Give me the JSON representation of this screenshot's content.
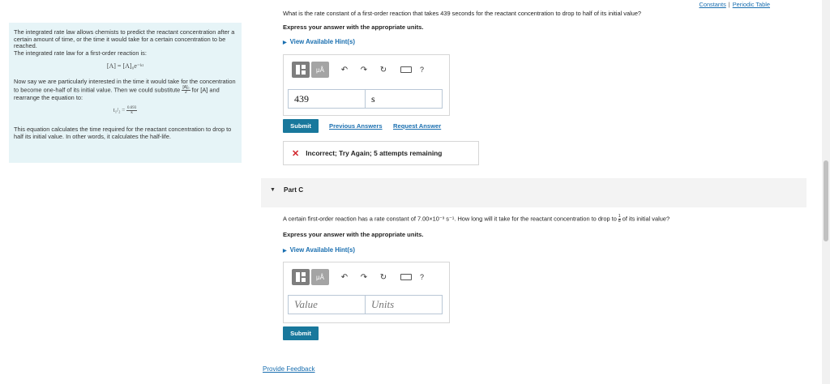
{
  "links": {
    "constants": "Constants",
    "separator": "|",
    "periodic_table": "Periodic Table"
  },
  "info": {
    "p1": "The integrated rate law allows chemists to predict the reactant concentration after a certain amount of time, or the time it would take for a certain concentration to be reached.",
    "p2": "The integrated rate law for a first-order reaction is:",
    "eq1": "[A] = [A]₀e⁻ᵏᵗ",
    "p3a": "Now say we are particularly interested in the time it would take for the concentration to become one-half of its initial value. Then we could substitute",
    "p3_frac_num": "[A]₀",
    "p3_frac_den": "2",
    "p3b": "for [A] and rearrange the equation to:",
    "eq2_lhs": "t₁/₂ =",
    "eq2_num": "0.693",
    "eq2_den": "k",
    "p4": "This equation calculates the time required for the reactant concentration to drop to half its initial value. In other words, it calculates the half-life."
  },
  "partB": {
    "question": "What is the rate constant of a first-order reaction that takes 439 seconds for the reactant concentration to drop to half of its initial value?",
    "express": "Express your answer with the appropriate units.",
    "hint": "View Available Hint(s)",
    "value": "439",
    "units": "s",
    "submit": "Submit",
    "previous_answers": "Previous Answers",
    "request_answer": "Request Answer",
    "feedback": "Incorrect; Try Again; 5 attempts remaining"
  },
  "partC": {
    "label": "Part C",
    "question_a": "A certain first-order reaction has a rate constant of 7.00×10⁻³ s⁻¹. How long will it take for the reactant concentration to drop to",
    "frac_num": "1",
    "frac_den": "8",
    "question_b": "of its initial value?",
    "express": "Express your answer with the appropriate units.",
    "hint": "View Available Hint(s)",
    "value_placeholder": "Value",
    "units_placeholder": "Units",
    "submit": "Submit"
  },
  "toolbar": {
    "mu_label": "μÅ",
    "undo": "↶",
    "redo": "↷",
    "reset": "↻",
    "help": "?"
  },
  "footer": {
    "provide_feedback": "Provide Feedback"
  }
}
